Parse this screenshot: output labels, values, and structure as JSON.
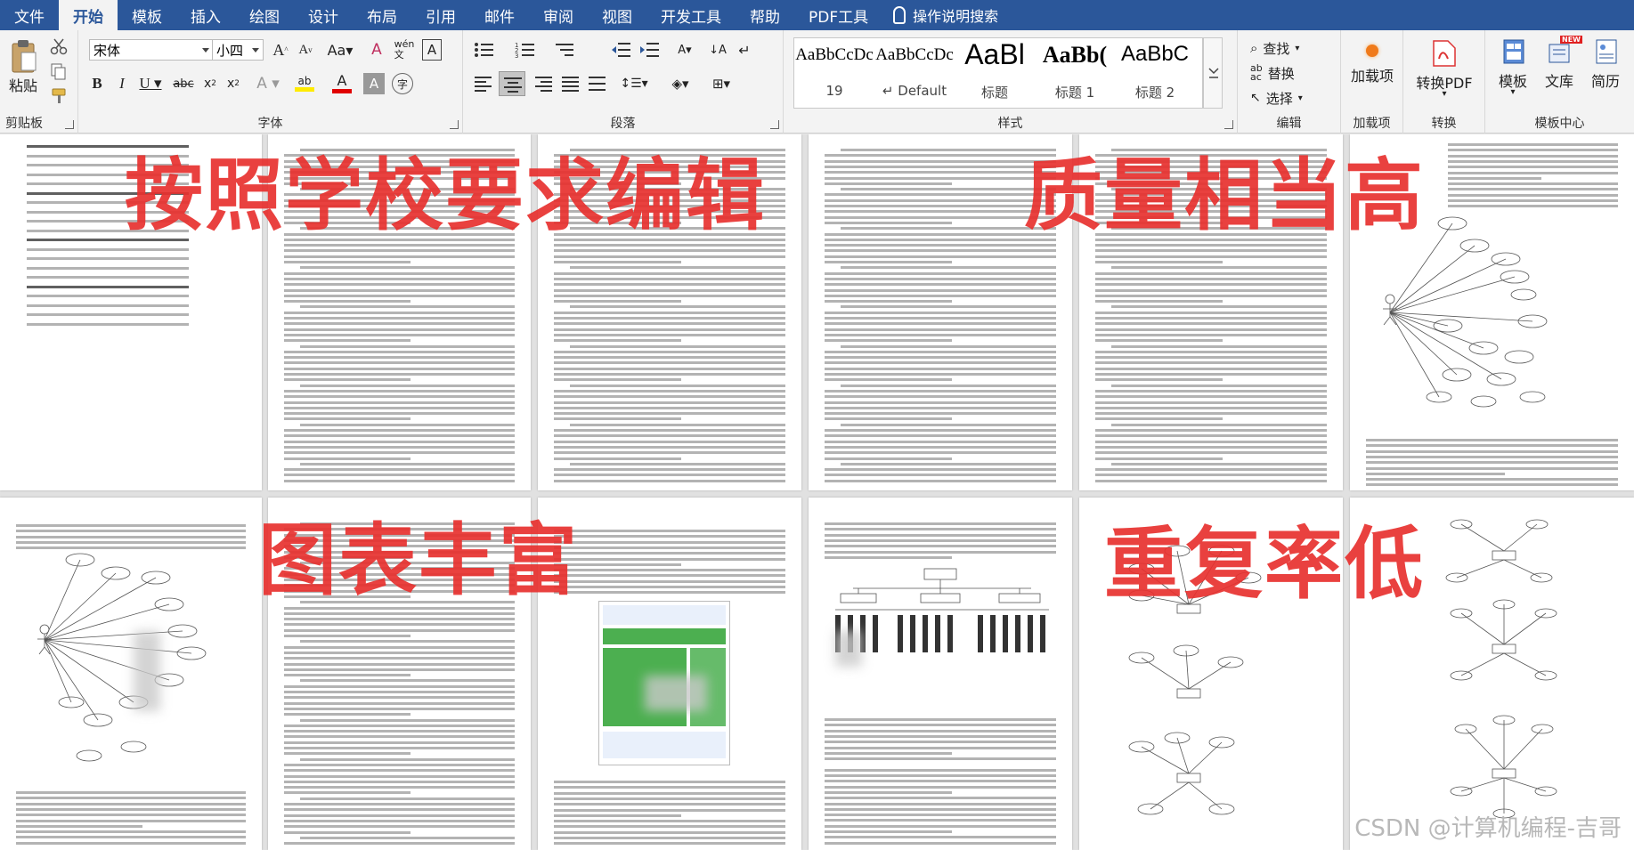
{
  "menu": {
    "tabs": [
      "文件",
      "开始",
      "模板",
      "插入",
      "绘图",
      "设计",
      "布局",
      "引用",
      "邮件",
      "审阅",
      "视图",
      "开发工具",
      "帮助",
      "PDF工具"
    ],
    "active_index": 1,
    "tell_me": "操作说明搜索"
  },
  "ribbon": {
    "clipboard": {
      "paste": "粘贴",
      "label": "剪贴板"
    },
    "font": {
      "family": "宋体",
      "size": "小四",
      "label": "字体"
    },
    "paragraph": {
      "label": "段落"
    },
    "styles": {
      "label": "样式",
      "items": [
        {
          "preview": "AaBbCcDc",
          "name": "19"
        },
        {
          "preview": "AaBbCcDc",
          "name": "Default"
        },
        {
          "preview": "AaBl",
          "name": "标题"
        },
        {
          "preview": "AaBb(",
          "name": "标题 1"
        },
        {
          "preview": "AaBbC",
          "name": "标题 2"
        }
      ]
    },
    "editing": {
      "find": "查找",
      "replace": "替换",
      "select": "选择",
      "label": "编辑"
    },
    "addins": {
      "button": "加载项",
      "label": "加载项"
    },
    "convert": {
      "button": "转换PDF",
      "label": "转换"
    },
    "templates": {
      "template": "模板",
      "library": "文库",
      "simple": "简历",
      "new_badge": "NEW",
      "label": "模板中心"
    }
  },
  "overlays": {
    "top_left": "按照学校要求编辑",
    "top_right": "质量相当高",
    "bottom_left": "图表丰富",
    "bottom_right": "重复率低"
  },
  "watermark": "CSDN @计算机编程-吉哥",
  "colors": {
    "menubar": "#2b579a",
    "overlay_text": "#e8312f",
    "figure_green": "#4caf50"
  }
}
